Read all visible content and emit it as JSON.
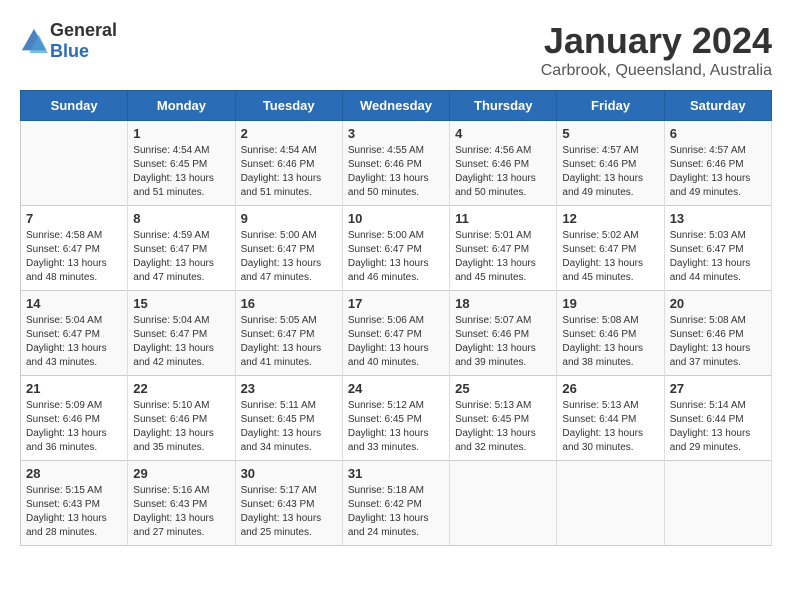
{
  "header": {
    "logo_general": "General",
    "logo_blue": "Blue",
    "month_title": "January 2024",
    "location": "Carbrook, Queensland, Australia"
  },
  "weekdays": [
    "Sunday",
    "Monday",
    "Tuesday",
    "Wednesday",
    "Thursday",
    "Friday",
    "Saturday"
  ],
  "weeks": [
    [
      {
        "day": "",
        "sunrise": "",
        "sunset": "",
        "daylight": ""
      },
      {
        "day": "1",
        "sunrise": "Sunrise: 4:54 AM",
        "sunset": "Sunset: 6:45 PM",
        "daylight": "Daylight: 13 hours and 51 minutes."
      },
      {
        "day": "2",
        "sunrise": "Sunrise: 4:54 AM",
        "sunset": "Sunset: 6:46 PM",
        "daylight": "Daylight: 13 hours and 51 minutes."
      },
      {
        "day": "3",
        "sunrise": "Sunrise: 4:55 AM",
        "sunset": "Sunset: 6:46 PM",
        "daylight": "Daylight: 13 hours and 50 minutes."
      },
      {
        "day": "4",
        "sunrise": "Sunrise: 4:56 AM",
        "sunset": "Sunset: 6:46 PM",
        "daylight": "Daylight: 13 hours and 50 minutes."
      },
      {
        "day": "5",
        "sunrise": "Sunrise: 4:57 AM",
        "sunset": "Sunset: 6:46 PM",
        "daylight": "Daylight: 13 hours and 49 minutes."
      },
      {
        "day": "6",
        "sunrise": "Sunrise: 4:57 AM",
        "sunset": "Sunset: 6:46 PM",
        "daylight": "Daylight: 13 hours and 49 minutes."
      }
    ],
    [
      {
        "day": "7",
        "sunrise": "Sunrise: 4:58 AM",
        "sunset": "Sunset: 6:47 PM",
        "daylight": "Daylight: 13 hours and 48 minutes."
      },
      {
        "day": "8",
        "sunrise": "Sunrise: 4:59 AM",
        "sunset": "Sunset: 6:47 PM",
        "daylight": "Daylight: 13 hours and 47 minutes."
      },
      {
        "day": "9",
        "sunrise": "Sunrise: 5:00 AM",
        "sunset": "Sunset: 6:47 PM",
        "daylight": "Daylight: 13 hours and 47 minutes."
      },
      {
        "day": "10",
        "sunrise": "Sunrise: 5:00 AM",
        "sunset": "Sunset: 6:47 PM",
        "daylight": "Daylight: 13 hours and 46 minutes."
      },
      {
        "day": "11",
        "sunrise": "Sunrise: 5:01 AM",
        "sunset": "Sunset: 6:47 PM",
        "daylight": "Daylight: 13 hours and 45 minutes."
      },
      {
        "day": "12",
        "sunrise": "Sunrise: 5:02 AM",
        "sunset": "Sunset: 6:47 PM",
        "daylight": "Daylight: 13 hours and 45 minutes."
      },
      {
        "day": "13",
        "sunrise": "Sunrise: 5:03 AM",
        "sunset": "Sunset: 6:47 PM",
        "daylight": "Daylight: 13 hours and 44 minutes."
      }
    ],
    [
      {
        "day": "14",
        "sunrise": "Sunrise: 5:04 AM",
        "sunset": "Sunset: 6:47 PM",
        "daylight": "Daylight: 13 hours and 43 minutes."
      },
      {
        "day": "15",
        "sunrise": "Sunrise: 5:04 AM",
        "sunset": "Sunset: 6:47 PM",
        "daylight": "Daylight: 13 hours and 42 minutes."
      },
      {
        "day": "16",
        "sunrise": "Sunrise: 5:05 AM",
        "sunset": "Sunset: 6:47 PM",
        "daylight": "Daylight: 13 hours and 41 minutes."
      },
      {
        "day": "17",
        "sunrise": "Sunrise: 5:06 AM",
        "sunset": "Sunset: 6:47 PM",
        "daylight": "Daylight: 13 hours and 40 minutes."
      },
      {
        "day": "18",
        "sunrise": "Sunrise: 5:07 AM",
        "sunset": "Sunset: 6:46 PM",
        "daylight": "Daylight: 13 hours and 39 minutes."
      },
      {
        "day": "19",
        "sunrise": "Sunrise: 5:08 AM",
        "sunset": "Sunset: 6:46 PM",
        "daylight": "Daylight: 13 hours and 38 minutes."
      },
      {
        "day": "20",
        "sunrise": "Sunrise: 5:08 AM",
        "sunset": "Sunset: 6:46 PM",
        "daylight": "Daylight: 13 hours and 37 minutes."
      }
    ],
    [
      {
        "day": "21",
        "sunrise": "Sunrise: 5:09 AM",
        "sunset": "Sunset: 6:46 PM",
        "daylight": "Daylight: 13 hours and 36 minutes."
      },
      {
        "day": "22",
        "sunrise": "Sunrise: 5:10 AM",
        "sunset": "Sunset: 6:46 PM",
        "daylight": "Daylight: 13 hours and 35 minutes."
      },
      {
        "day": "23",
        "sunrise": "Sunrise: 5:11 AM",
        "sunset": "Sunset: 6:45 PM",
        "daylight": "Daylight: 13 hours and 34 minutes."
      },
      {
        "day": "24",
        "sunrise": "Sunrise: 5:12 AM",
        "sunset": "Sunset: 6:45 PM",
        "daylight": "Daylight: 13 hours and 33 minutes."
      },
      {
        "day": "25",
        "sunrise": "Sunrise: 5:13 AM",
        "sunset": "Sunset: 6:45 PM",
        "daylight": "Daylight: 13 hours and 32 minutes."
      },
      {
        "day": "26",
        "sunrise": "Sunrise: 5:13 AM",
        "sunset": "Sunset: 6:44 PM",
        "daylight": "Daylight: 13 hours and 30 minutes."
      },
      {
        "day": "27",
        "sunrise": "Sunrise: 5:14 AM",
        "sunset": "Sunset: 6:44 PM",
        "daylight": "Daylight: 13 hours and 29 minutes."
      }
    ],
    [
      {
        "day": "28",
        "sunrise": "Sunrise: 5:15 AM",
        "sunset": "Sunset: 6:43 PM",
        "daylight": "Daylight: 13 hours and 28 minutes."
      },
      {
        "day": "29",
        "sunrise": "Sunrise: 5:16 AM",
        "sunset": "Sunset: 6:43 PM",
        "daylight": "Daylight: 13 hours and 27 minutes."
      },
      {
        "day": "30",
        "sunrise": "Sunrise: 5:17 AM",
        "sunset": "Sunset: 6:43 PM",
        "daylight": "Daylight: 13 hours and 25 minutes."
      },
      {
        "day": "31",
        "sunrise": "Sunrise: 5:18 AM",
        "sunset": "Sunset: 6:42 PM",
        "daylight": "Daylight: 13 hours and 24 minutes."
      },
      {
        "day": "",
        "sunrise": "",
        "sunset": "",
        "daylight": ""
      },
      {
        "day": "",
        "sunrise": "",
        "sunset": "",
        "daylight": ""
      },
      {
        "day": "",
        "sunrise": "",
        "sunset": "",
        "daylight": ""
      }
    ]
  ]
}
